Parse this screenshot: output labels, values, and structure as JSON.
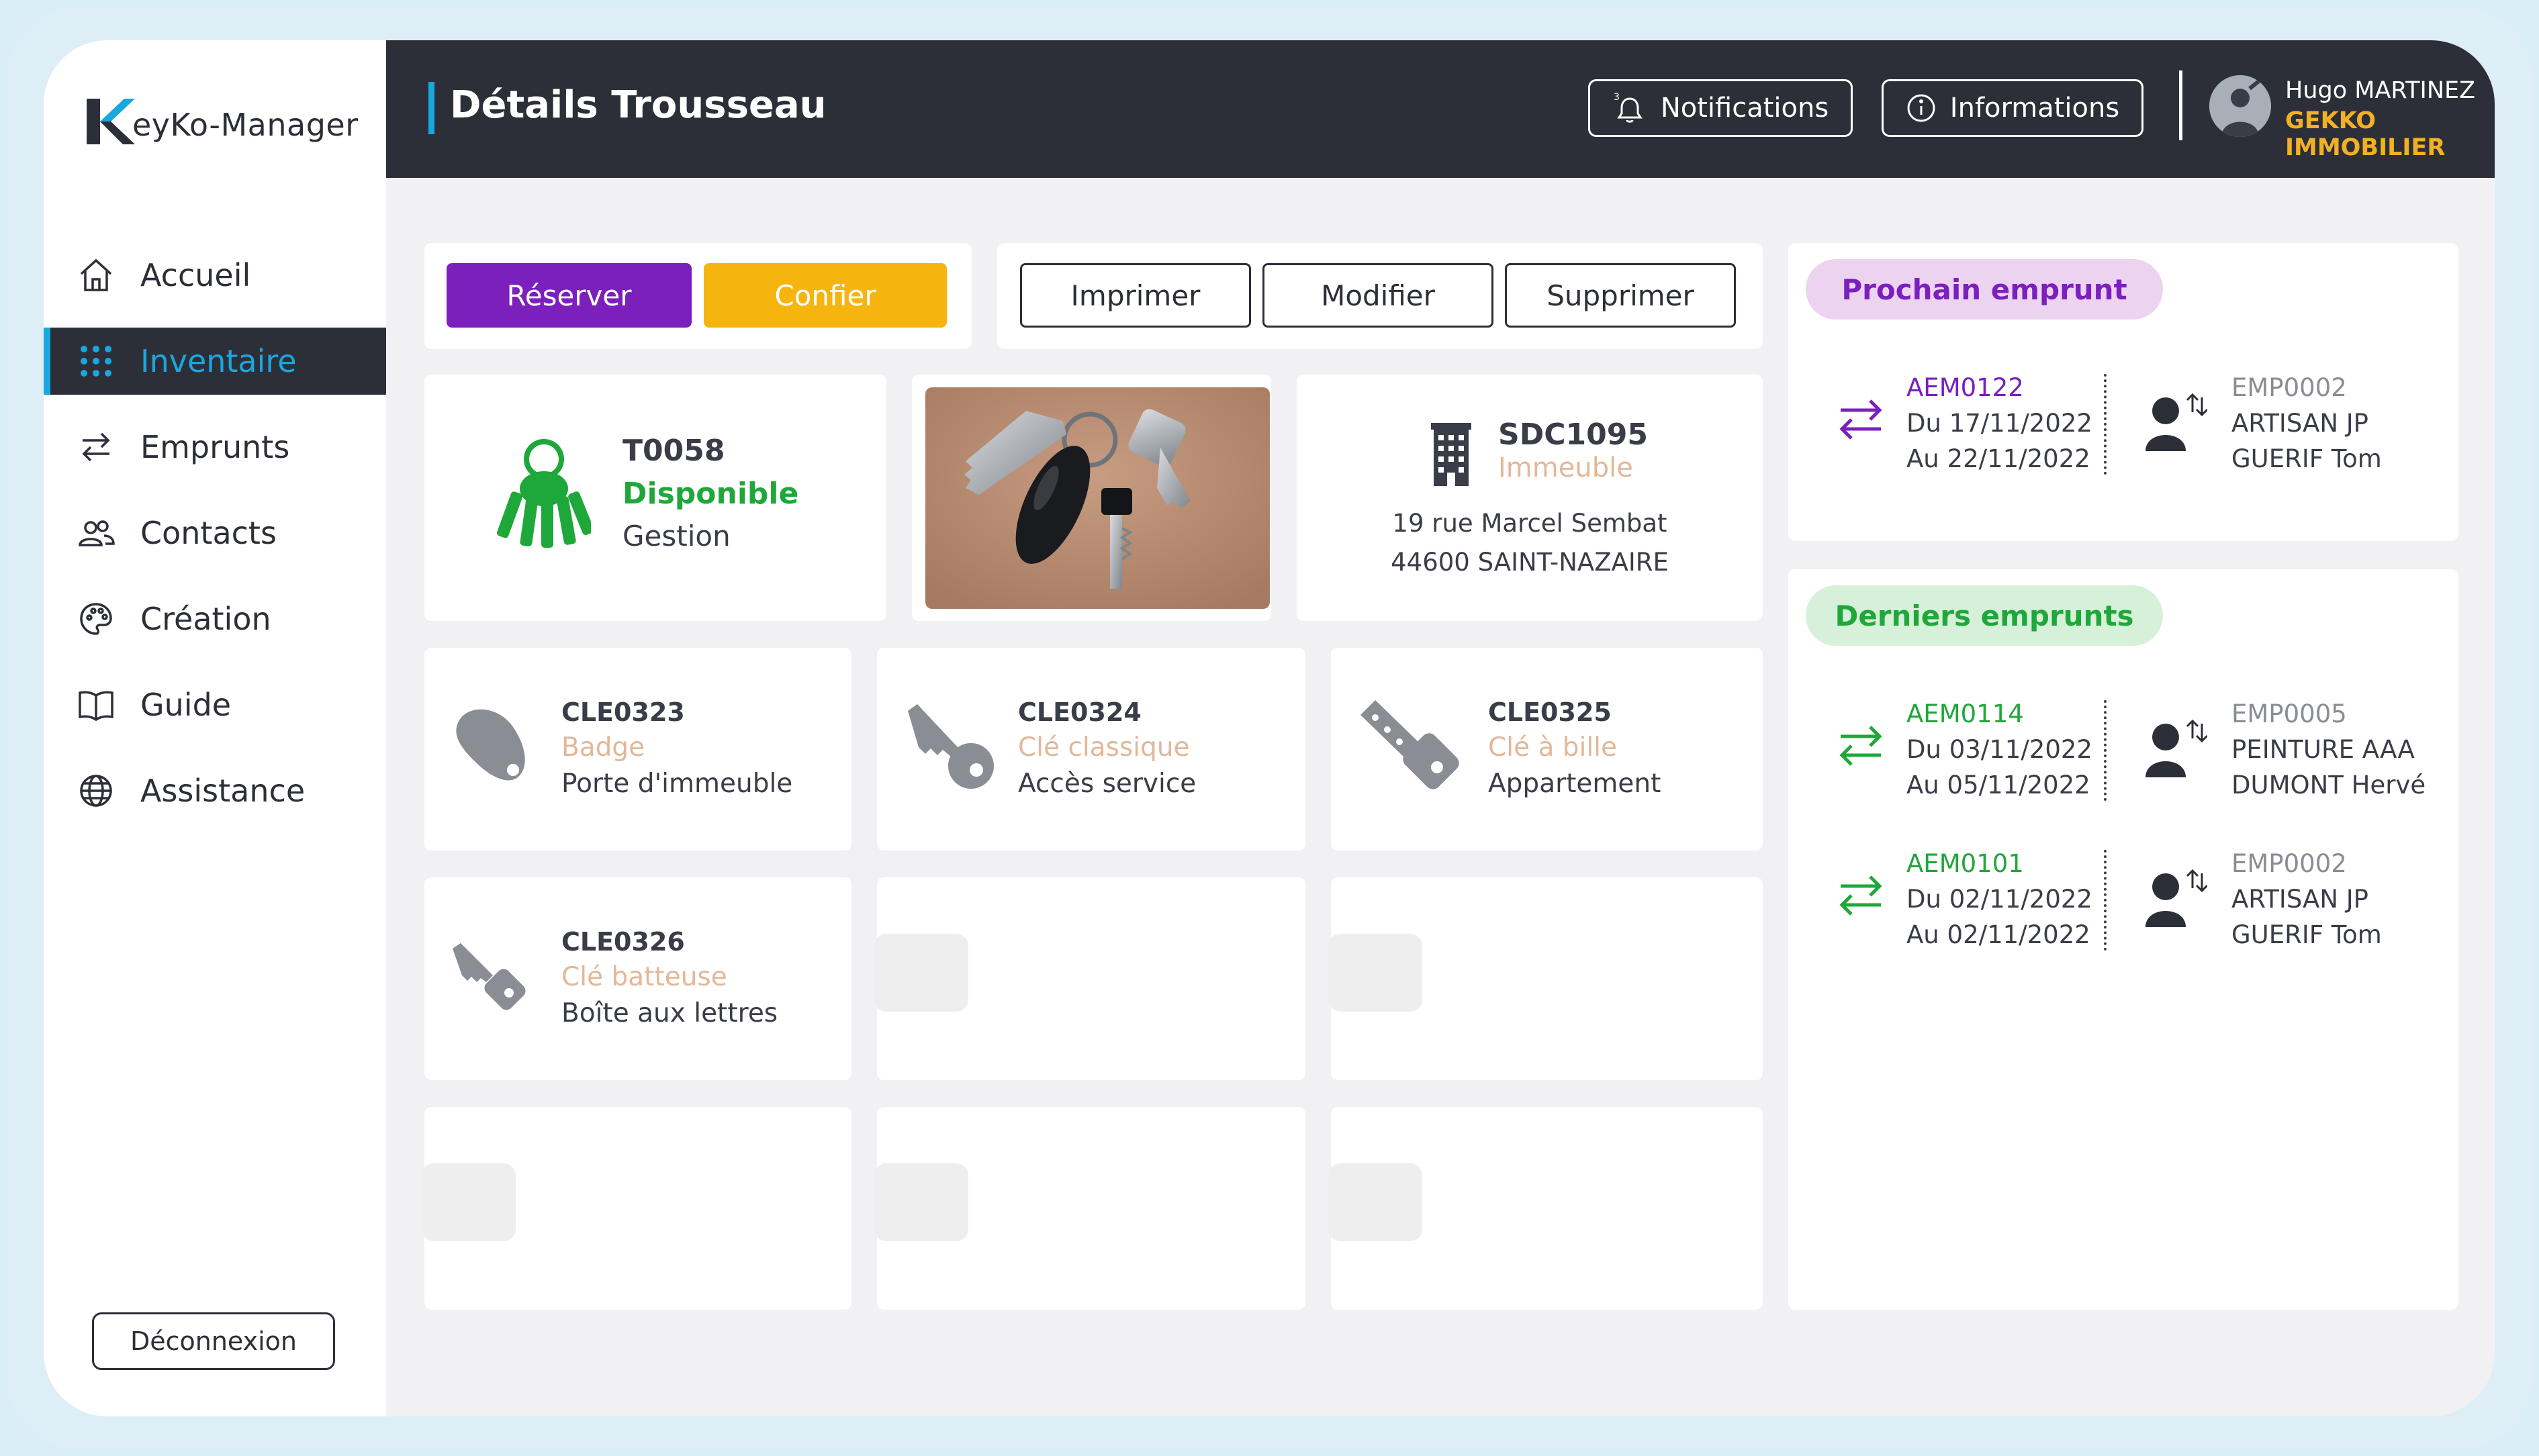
{
  "app": {
    "logo_letter": "K",
    "logo_text": "eyKo-Manager"
  },
  "sidebar": {
    "items": [
      {
        "label": "Accueil",
        "icon": "home-icon"
      },
      {
        "label": "Inventaire",
        "icon": "grid-icon",
        "active": true
      },
      {
        "label": "Emprunts",
        "icon": "swap-icon"
      },
      {
        "label": "Contacts",
        "icon": "users-icon"
      },
      {
        "label": "Création",
        "icon": "palette-icon"
      },
      {
        "label": "Guide",
        "icon": "book-icon"
      },
      {
        "label": "Assistance",
        "icon": "globe-icon"
      }
    ],
    "logout_label": "Déconnexion"
  },
  "header": {
    "title": "Détails Trousseau",
    "notifications_label": "Notifications",
    "notifications_count": "3",
    "informations_label": "Informations",
    "user_name": "Hugo MARTINEZ",
    "user_company": "GEKKO IMMOBILIER"
  },
  "actions": {
    "reserve_label": "Réserver",
    "confier_label": "Confier",
    "print_label": "Imprimer",
    "edit_label": "Modifier",
    "delete_label": "Supprimer"
  },
  "trousseau": {
    "id": "T0058",
    "status": "Disponible",
    "type": "Gestion"
  },
  "site": {
    "id": "SDC1095",
    "kind": "Immeuble",
    "address_line1": "19 rue Marcel Sembat",
    "address_line2": "44600 SAINT-NAZAIRE"
  },
  "keys": [
    {
      "id": "CLE0323",
      "kind": "Badge",
      "usage": "Porte d'immeuble",
      "icon": "badge-icon"
    },
    {
      "id": "CLE0324",
      "kind": "Clé classique",
      "usage": "Accès service",
      "icon": "key-classic-icon"
    },
    {
      "id": "CLE0325",
      "kind": "Clé à bille",
      "usage": "Appartement",
      "icon": "key-dimple-icon"
    },
    {
      "id": "CLE0326",
      "kind": "Clé batteuse",
      "usage": "Boîte aux lettres",
      "icon": "key-mailbox-icon"
    }
  ],
  "next_loan": {
    "pill_label": "Prochain emprunt",
    "ref": "AEM0122",
    "from": "Du 17/11/2022",
    "to": "Au 22/11/2022",
    "borrower_id": "EMP0002",
    "borrower_company": "ARTISAN JP",
    "borrower_name": "GUERIF Tom"
  },
  "last_loans": {
    "pill_label": "Derniers emprunts",
    "items": [
      {
        "ref": "AEM0114",
        "from": "Du 03/11/2022",
        "to": "Au 05/11/2022",
        "borrower_id": "EMP0005",
        "borrower_company": "PEINTURE AAA",
        "borrower_name": "DUMONT Hervé"
      },
      {
        "ref": "AEM0101",
        "from": "Du 02/11/2022",
        "to": "Au 02/11/2022",
        "borrower_id": "EMP0002",
        "borrower_company": "ARTISAN JP",
        "borrower_name": "GUERIF Tom"
      }
    ]
  },
  "colors": {
    "dark": "#2d2f38",
    "accent_blue": "#19a7e0",
    "purple": "#7b1fbd",
    "yellow": "#f6b50e",
    "green": "#1fa83a",
    "peach": "#e2b899"
  }
}
